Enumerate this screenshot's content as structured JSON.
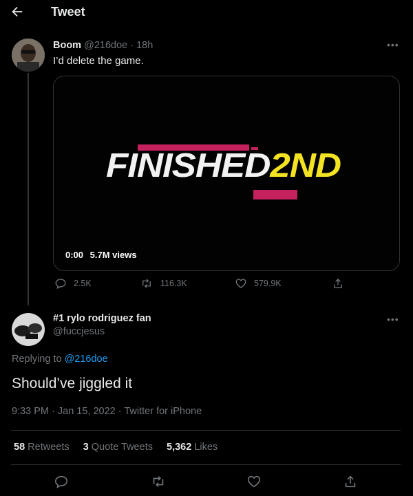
{
  "header": {
    "title": "Tweet"
  },
  "parent_tweet": {
    "name": "Boom",
    "handle": "@216doe",
    "time": "· 18h",
    "text": "I’d delete the game.",
    "media": {
      "banner_text_left": "FINISHED",
      "banner_text_right": "2ND",
      "video_time": "0:00",
      "views": "5.7M views"
    },
    "replies": "2.5K",
    "retweets": "116.3K",
    "likes": "579.9K"
  },
  "main_tweet": {
    "name": "#1 rylo rodriguez fan",
    "handle": "@fuccjesus",
    "replying_prefix": "Replying to",
    "replying_to": "@216doe",
    "text": "Should’ve jiggled it",
    "timestamp": "9:33 PM · Jan 15, 2022 · Twitter for iPhone",
    "stats": {
      "retweets_count": "58",
      "retweets_label": "Retweets",
      "quotes_count": "3",
      "quotes_label": "Quote Tweets",
      "likes_count": "5,362",
      "likes_label": "Likes"
    }
  },
  "colors": {
    "background": "#000000",
    "accent": "#1d9bf0",
    "muted": "#71767b",
    "highlight": "#f4e323"
  },
  "icons": [
    "back-arrow-icon",
    "more-icon",
    "reply-icon",
    "retweet-icon",
    "like-icon",
    "share-icon"
  ]
}
